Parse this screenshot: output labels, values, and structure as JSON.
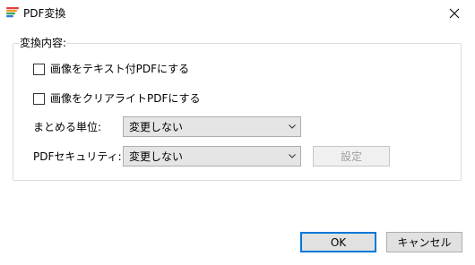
{
  "window": {
    "title": "PDF変換",
    "app_icon": "pdf-app-icon",
    "close_icon": "close-icon"
  },
  "group": {
    "label": "変換内容:"
  },
  "options": [
    {
      "label": "画像をテキスト付PDFにする",
      "checked": false
    },
    {
      "label": "画像をクリアライトPDFにする",
      "checked": false
    }
  ],
  "fields": {
    "unit_label": "まとめる単位:",
    "unit_value": "変更しない",
    "security_label": "PDFセキュリティ:",
    "security_value": "変更しない",
    "settings_button": "設定"
  },
  "footer": {
    "ok_label": "OK",
    "cancel_label": "キャンセル"
  },
  "colors": {
    "accent": "#0078d7",
    "button_face": "#e1e1e1",
    "group_border": "#dcdcdc"
  }
}
